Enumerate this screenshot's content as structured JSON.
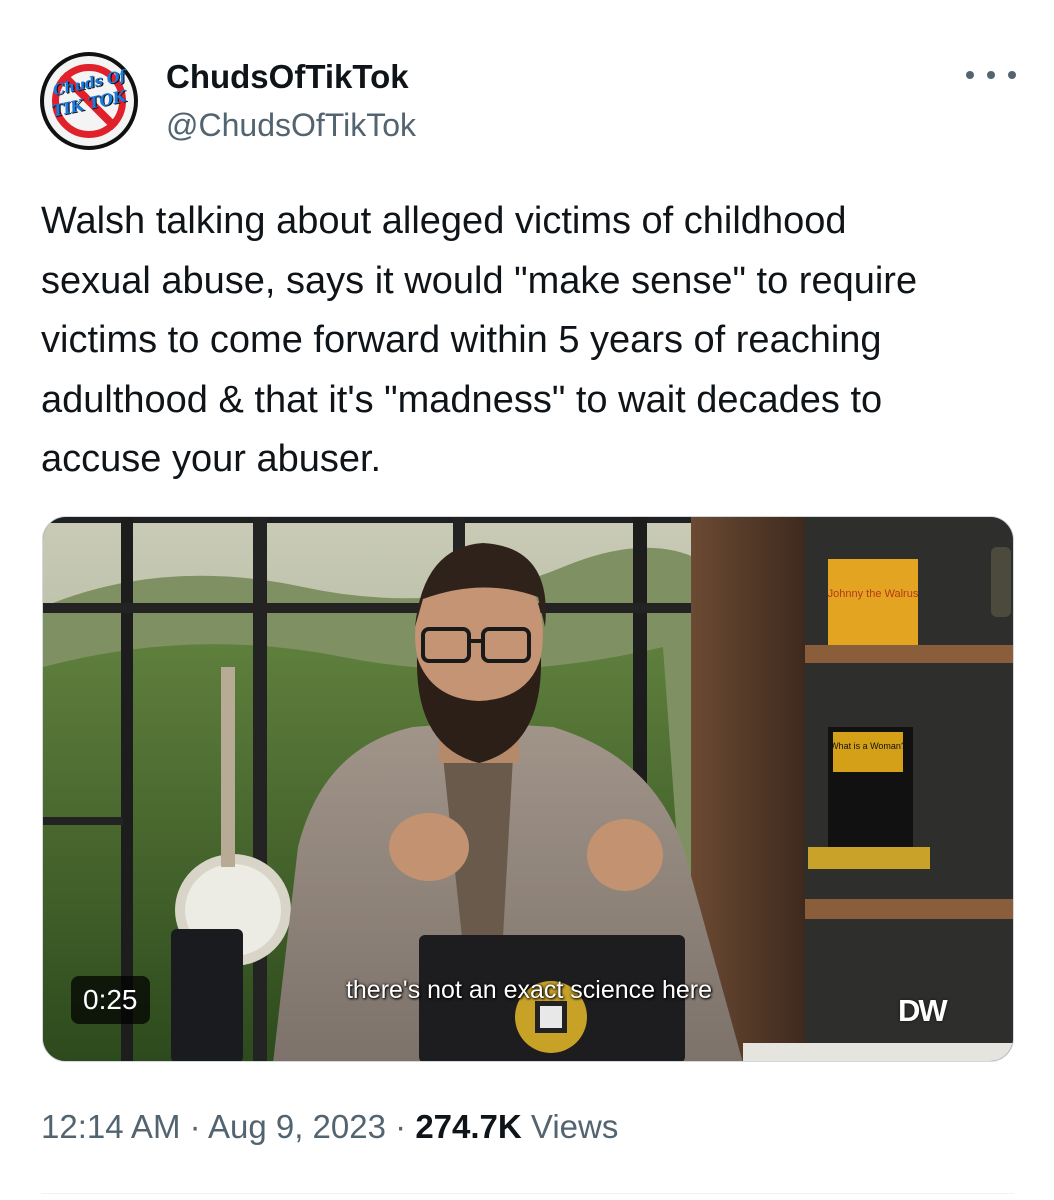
{
  "author": {
    "display_name": "ChudsOfTikTok",
    "handle": "@ChudsOfTikTok",
    "avatar_text_line1": "Chuds Of",
    "avatar_text_line2": "TIK TOK"
  },
  "tweet": {
    "text": "Walsh talking about alleged victims of childhood\nsexual abuse, says it would \"make sense\" to require\nvictims to come forward within 5 years of reaching\nadulthood & that it's \"madness\" to wait decades to\naccuse your abuser."
  },
  "media": {
    "duration": "0:25",
    "subtitle": "there's not an exact science here",
    "watermark": "DW",
    "book_title": "Johnny the Walrus",
    "book_title_2": "What is a Woman?"
  },
  "meta": {
    "time": "12:14 AM",
    "separator": "·",
    "date": "Aug 9, 2023",
    "views_count": "274.7K",
    "views_label": "Views"
  },
  "icons": {
    "more": "more-horizontal-icon"
  }
}
